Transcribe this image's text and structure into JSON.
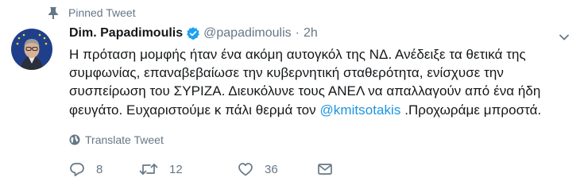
{
  "pinned": {
    "label": "Pinned Tweet",
    "icon": "pin-icon"
  },
  "author": {
    "display_name": "Dim. Papadimoulis",
    "handle": "@papadimoulis",
    "separator": "·",
    "time": "2h",
    "verified": true
  },
  "tweet": {
    "lines": [
      "Η πρόταση μομφής ήταν ένα ακόμη αυτογκόλ της ΝΔ. Ανέδειξε τα θετικά της",
      "συμφωνίας, επαναβεβαίωσε την κυβερνητική σταθερότητα, ενίσχυσε την",
      "συσπείρωση του ΣΥΡΙΖΑ. Διευκόλυνε τους ΑΝΕΛ να απαλλαγούν από ένα ήδη"
    ],
    "last_line_before": "φευγάτο. Ευχαριστούμε κ πάλι θερμά τον ",
    "mention": "@kmitsotakis",
    "last_line_after": " .Προχωράμε μπροστά."
  },
  "translate": {
    "label": "Translate Tweet"
  },
  "actions": {
    "reply_count": "8",
    "retweet_count": "12",
    "like_count": "36"
  },
  "colors": {
    "accent": "#1da1f2",
    "link": "#1b95e0",
    "muted": "#657786",
    "text": "#14171a"
  }
}
